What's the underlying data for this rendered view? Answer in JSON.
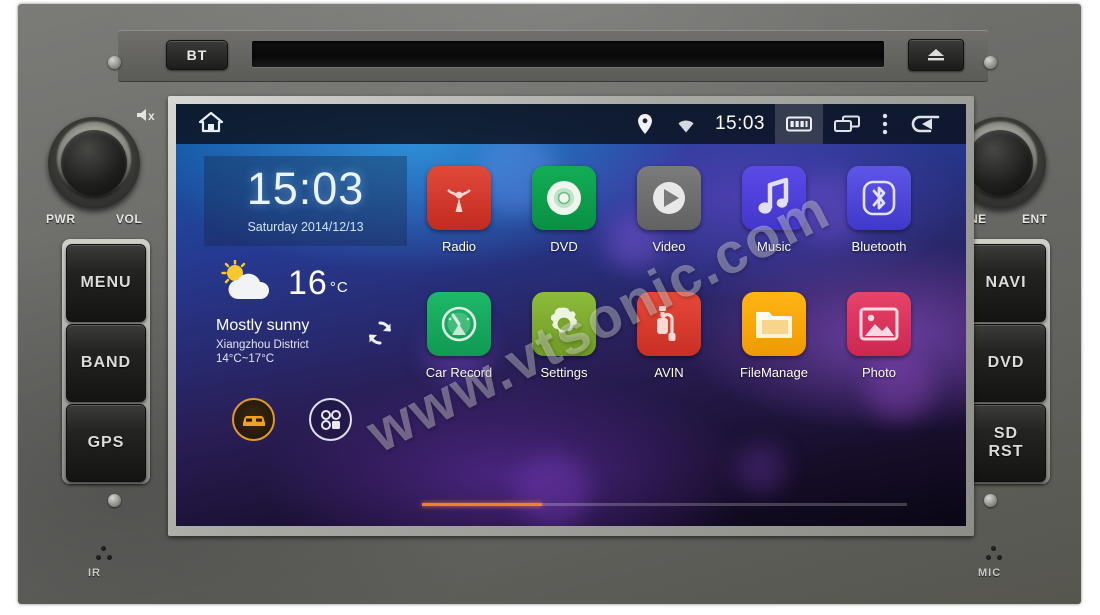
{
  "device": {
    "top_panel": {
      "bt_label": "BT",
      "eject_icon": "eject-icon",
      "disc_slot": "disc-slot"
    },
    "left_controls": {
      "mute_icon": "mute-icon",
      "knob_left_label": "PWR",
      "knob_right_label": "VOL",
      "buttons": [
        {
          "label": "MENU",
          "name": "menu-button"
        },
        {
          "label": "BAND",
          "name": "band-button"
        },
        {
          "label": "GPS",
          "name": "gps-button"
        }
      ]
    },
    "right_controls": {
      "knob_left_label": "TUNE",
      "knob_right_label": "ENT",
      "buttons": [
        {
          "label": "NAVI",
          "name": "navi-button"
        },
        {
          "label": "DVD",
          "name": "dvd-button"
        },
        {
          "label": "SD\nRST",
          "line1": "SD",
          "line2": "RST",
          "name": "sd-rst-button"
        }
      ]
    },
    "bottom_labels": {
      "ir": "IR",
      "mic": "MIC"
    }
  },
  "screen": {
    "statusbar": {
      "home_icon": "home-icon",
      "location_icon": "location-pin-icon",
      "wifi_icon": "wifi-icon",
      "time": "15:03",
      "screenshot_icon": "screenshot-icon",
      "recents_icon": "recent-apps-icon",
      "overflow_icon": "overflow-menu-icon",
      "back_icon": "back-arrow-icon"
    },
    "clock_widget": {
      "time": "15:03",
      "date": "Saturday 2014/12/13"
    },
    "weather_widget": {
      "icon": "sun-behind-cloud-icon",
      "temperature": "16",
      "unit": "°C",
      "condition": "Mostly sunny",
      "location_range": "Xiangzhou District 14°C~17°C",
      "refresh_icon": "refresh-icon"
    },
    "dock": [
      {
        "name": "car-shortcut",
        "icon": "car-icon"
      },
      {
        "name": "app-drawer-shortcut",
        "icon": "apps-grid-icon"
      }
    ],
    "apps": [
      {
        "label": "Radio",
        "icon": "radio-antenna-icon",
        "color": "#d0332a",
        "name": "app-radio"
      },
      {
        "label": "DVD",
        "icon": "disc-icon",
        "color": "#0e9f4d",
        "name": "app-dvd"
      },
      {
        "label": "Video",
        "icon": "play-circle-icon",
        "color": "#6f6f6f",
        "name": "app-video"
      },
      {
        "label": "Music",
        "icon": "music-note-icon",
        "color": "#4b3fd8",
        "name": "app-music"
      },
      {
        "label": "Bluetooth",
        "icon": "bluetooth-icon",
        "color": "#4b46d6",
        "name": "app-bluetooth"
      },
      {
        "label": "Car Record",
        "icon": "gauge-icon",
        "color": "#17a05c",
        "name": "app-car-record"
      },
      {
        "label": "Settings",
        "icon": "gear-icon",
        "color": "#7aaa2e",
        "name": "app-settings"
      },
      {
        "label": "AVIN",
        "icon": "av-input-icon",
        "color": "#dc3b2f",
        "name": "app-avin"
      },
      {
        "label": "FileManage",
        "icon": "folder-icon",
        "color": "#f5a50b",
        "name": "app-filemanage"
      },
      {
        "label": "Photo",
        "icon": "picture-icon",
        "color": "#d93358",
        "name": "app-photo"
      }
    ],
    "page_indicator": {
      "pages": 4,
      "current": 1
    },
    "watermark": "www.vtsonic.com"
  }
}
